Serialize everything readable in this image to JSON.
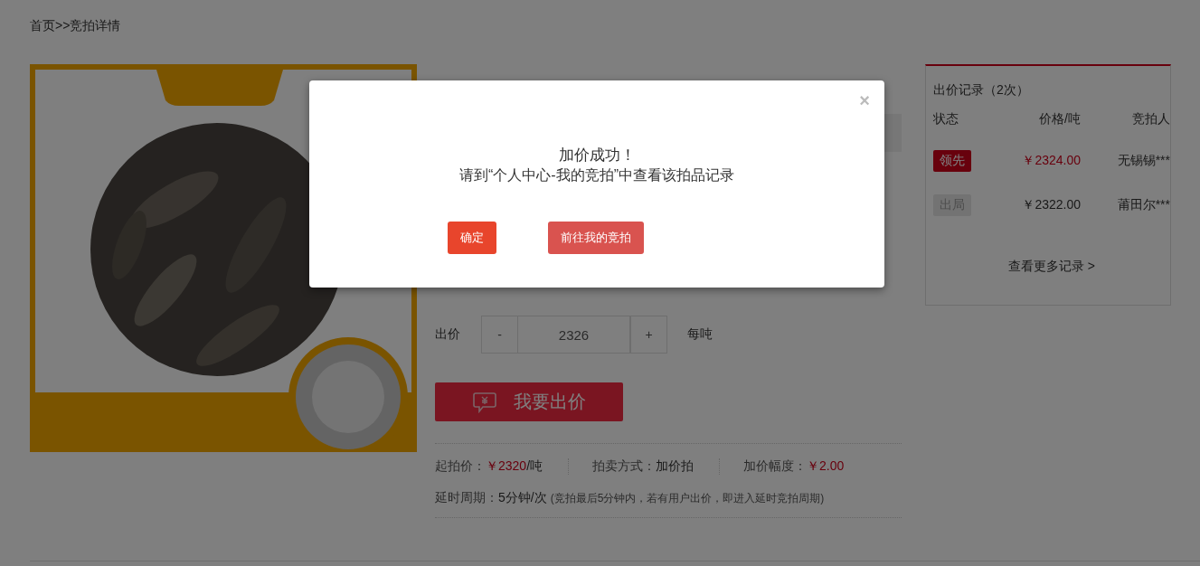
{
  "breadcrumb": {
    "items": [
      "首页",
      "竞拍详情"
    ],
    "separator": ">>"
  },
  "bid": {
    "label": "出价",
    "decrement": "-",
    "value": "2326",
    "increment": "+",
    "unit": "每吨",
    "submit": "我要出价"
  },
  "info": [
    {
      "label": "起拍价：",
      "value": "￥2320",
      "suffix": "/吨",
      "highlight": true
    },
    {
      "label": "拍卖方式：",
      "value": "加价拍",
      "highlight": false
    },
    {
      "label": "加价幅度：",
      "value": "￥2.00",
      "highlight": true
    }
  ],
  "delay": {
    "label": "延时周期：",
    "value": "5分钟/次",
    "note": "(竞拍最后5分钟内，若有用户出价，即进入延时竞拍周期)"
  },
  "records": {
    "title": "出价记录（2次）",
    "columns": [
      "状态",
      "价格/吨",
      "竞拍人"
    ],
    "rows": [
      {
        "status": "领先",
        "kind": "lead",
        "price": "￥2324.00",
        "bidder": "无锡锡***"
      },
      {
        "status": "出局",
        "kind": "out",
        "price": "￥2322.00",
        "bidder": "莆田尔***"
      }
    ],
    "more": "查看更多记录 >"
  },
  "dialog": {
    "close": "×",
    "title": "加价成功！",
    "message": "请到“个人中心-我的竞拍”中查看该拍品记录",
    "buttons": [
      {
        "label": "确定",
        "kind": "primary"
      },
      {
        "label": "前往我的竞拍",
        "kind": "secondary"
      }
    ]
  }
}
